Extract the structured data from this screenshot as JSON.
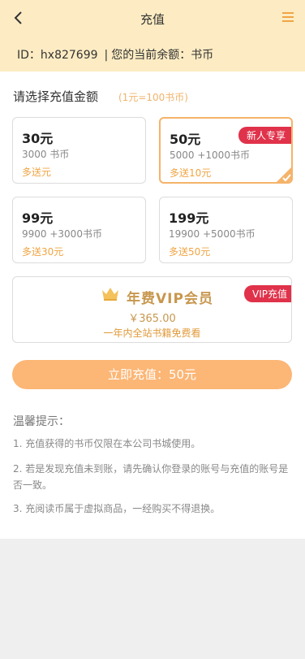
{
  "header": {
    "title": "充值",
    "back_icon": "chevron-left-icon",
    "menu_icon": "hamburger-menu-icon",
    "accent_color": "#f0a544",
    "background": "#fdecc3"
  },
  "account": {
    "id_label": "ID：",
    "id_value": "hx827699",
    "separator": "|",
    "balance_label": "您的当前余额：",
    "balance_value": "书币"
  },
  "recharge": {
    "section_title": "请选择充值金额",
    "rate_hint": "(1元=100书币)",
    "options": [
      {
        "amount": "30元",
        "coins": "3000 书币",
        "bonus": "多送元",
        "selected": false
      },
      {
        "amount": "50元",
        "coins": "5000 +1000书币",
        "bonus": "多送10元",
        "selected": true,
        "badge": "新人专享"
      },
      {
        "amount": "99元",
        "coins": "9900 +3000书币",
        "bonus": "多送30元",
        "selected": false
      },
      {
        "amount": "199元",
        "coins": "19900 +5000书币",
        "bonus": "多送50元",
        "selected": false
      }
    ],
    "vip": {
      "title": "年费VIP会员",
      "price": "￥365.00",
      "description": "一年内全站书籍免费看",
      "badge": "VIP充值",
      "icon": "crown-icon"
    },
    "pay_button": "立即充值：50元"
  },
  "tips": {
    "title": "温馨提示：",
    "items": [
      "1. 充值获得的书币仅限在本公司书城使用。",
      "2. 若是发现充值未到账，请先确认你登录的账号与充值的账号是否一致。",
      "3. 充阅读币属于虚拟商品，一经购买不得退换。"
    ]
  }
}
